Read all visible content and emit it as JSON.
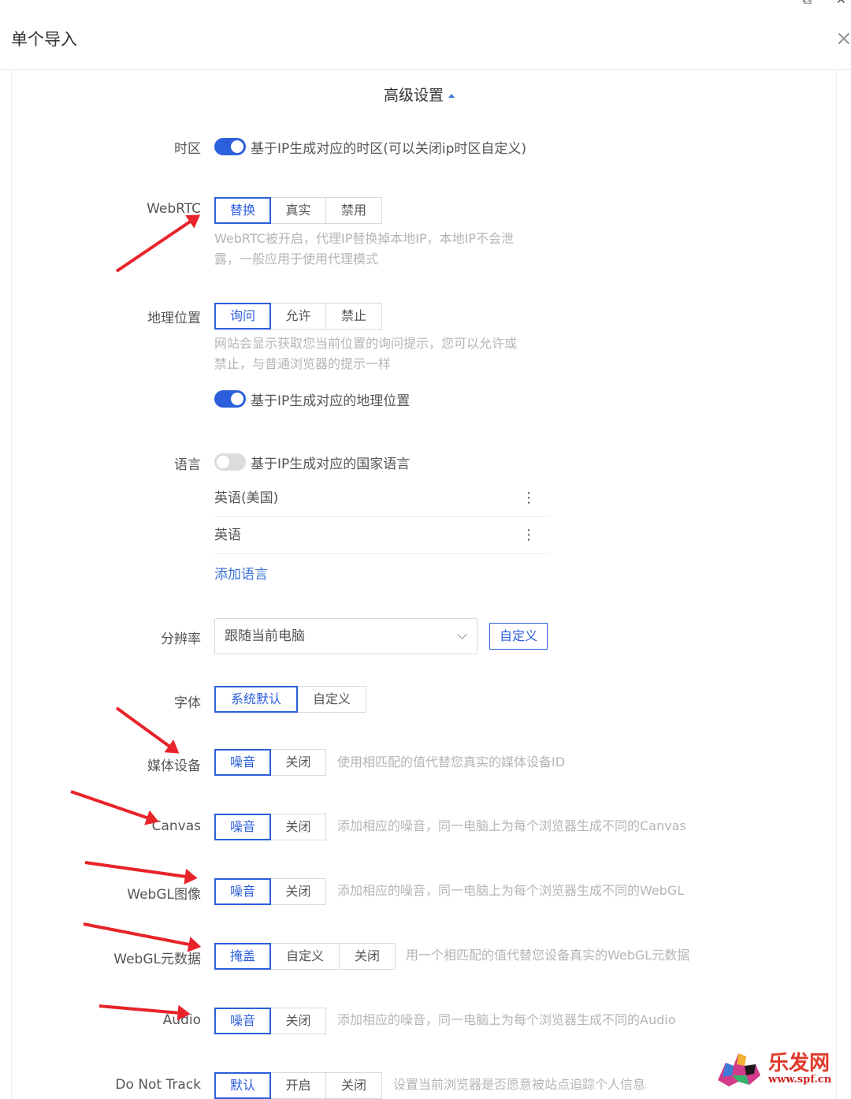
{
  "dialog": {
    "title": "单个导入",
    "close": "×"
  },
  "section": {
    "title": "高级设置"
  },
  "timezone": {
    "label": "时区",
    "toggle_on": true,
    "toggle_text": "基于IP生成对应的时区(可以关闭ip时区自定义)"
  },
  "webrtc": {
    "label": "WebRTC",
    "options": [
      "替换",
      "真实",
      "禁用"
    ],
    "selected": "替换",
    "hint_line1": "WebRTC被开启，代理IP替换掉本地IP，本地IP不会泄",
    "hint_line2": "露，一般应用于使用代理模式"
  },
  "geo": {
    "label": "地理位置",
    "options": [
      "询问",
      "允许",
      "禁止"
    ],
    "selected": "询问",
    "hint_line1": "网站会显示获取您当前位置的询问提示，您可以允许或",
    "hint_line2": "禁止，与普通浏览器的提示一样",
    "toggle_on": true,
    "toggle_text": "基于IP生成对应的地理位置"
  },
  "language": {
    "label": "语言",
    "toggle_on": false,
    "toggle_text": "基于IP生成对应的国家语言",
    "items": [
      "英语(美国)",
      "英语"
    ],
    "add_link": "添加语言"
  },
  "resolution": {
    "label": "分辨率",
    "value": "跟随当前电脑",
    "custom_button": "自定义"
  },
  "font": {
    "label": "字体",
    "options": [
      "系统默认",
      "自定义"
    ],
    "selected": "系统默认"
  },
  "media": {
    "label": "媒体设备",
    "options": [
      "噪音",
      "关闭"
    ],
    "selected": "噪音",
    "hint": "使用相匹配的值代替您真实的媒体设备ID"
  },
  "canvas": {
    "label": "Canvas",
    "options": [
      "噪音",
      "关闭"
    ],
    "selected": "噪音",
    "hint": "添加相应的噪音，同一电脑上为每个浏览器生成不同的Canvas"
  },
  "webgl_image": {
    "label": "WebGL图像",
    "options": [
      "噪音",
      "关闭"
    ],
    "selected": "噪音",
    "hint": "添加相应的噪音，同一电脑上为每个浏览器生成不同的WebGL"
  },
  "webgl_meta": {
    "label": "WebGL元数据",
    "options": [
      "掩盖",
      "自定义",
      "关闭"
    ],
    "selected": "掩盖",
    "hint": "用一个相匹配的值代替您设备真实的WebGL元数据"
  },
  "audio": {
    "label": "Audio",
    "options": [
      "噪音",
      "关闭"
    ],
    "selected": "噪音",
    "hint": "添加相应的噪音，同一电脑上为每个浏览器生成不同的Audio"
  },
  "dnt": {
    "label": "Do Not Track",
    "options": [
      "默认",
      "开启",
      "关闭"
    ],
    "selected": "默认",
    "hint": "设置当前浏览器是否愿意被站点追踪个人信息"
  },
  "watermark": {
    "brand": "乐发网",
    "url": "www.spf.cn"
  },
  "colors": {
    "accent": "#2c5fdc",
    "arrow": "#e8232a",
    "hint": "#b5b5b5"
  }
}
